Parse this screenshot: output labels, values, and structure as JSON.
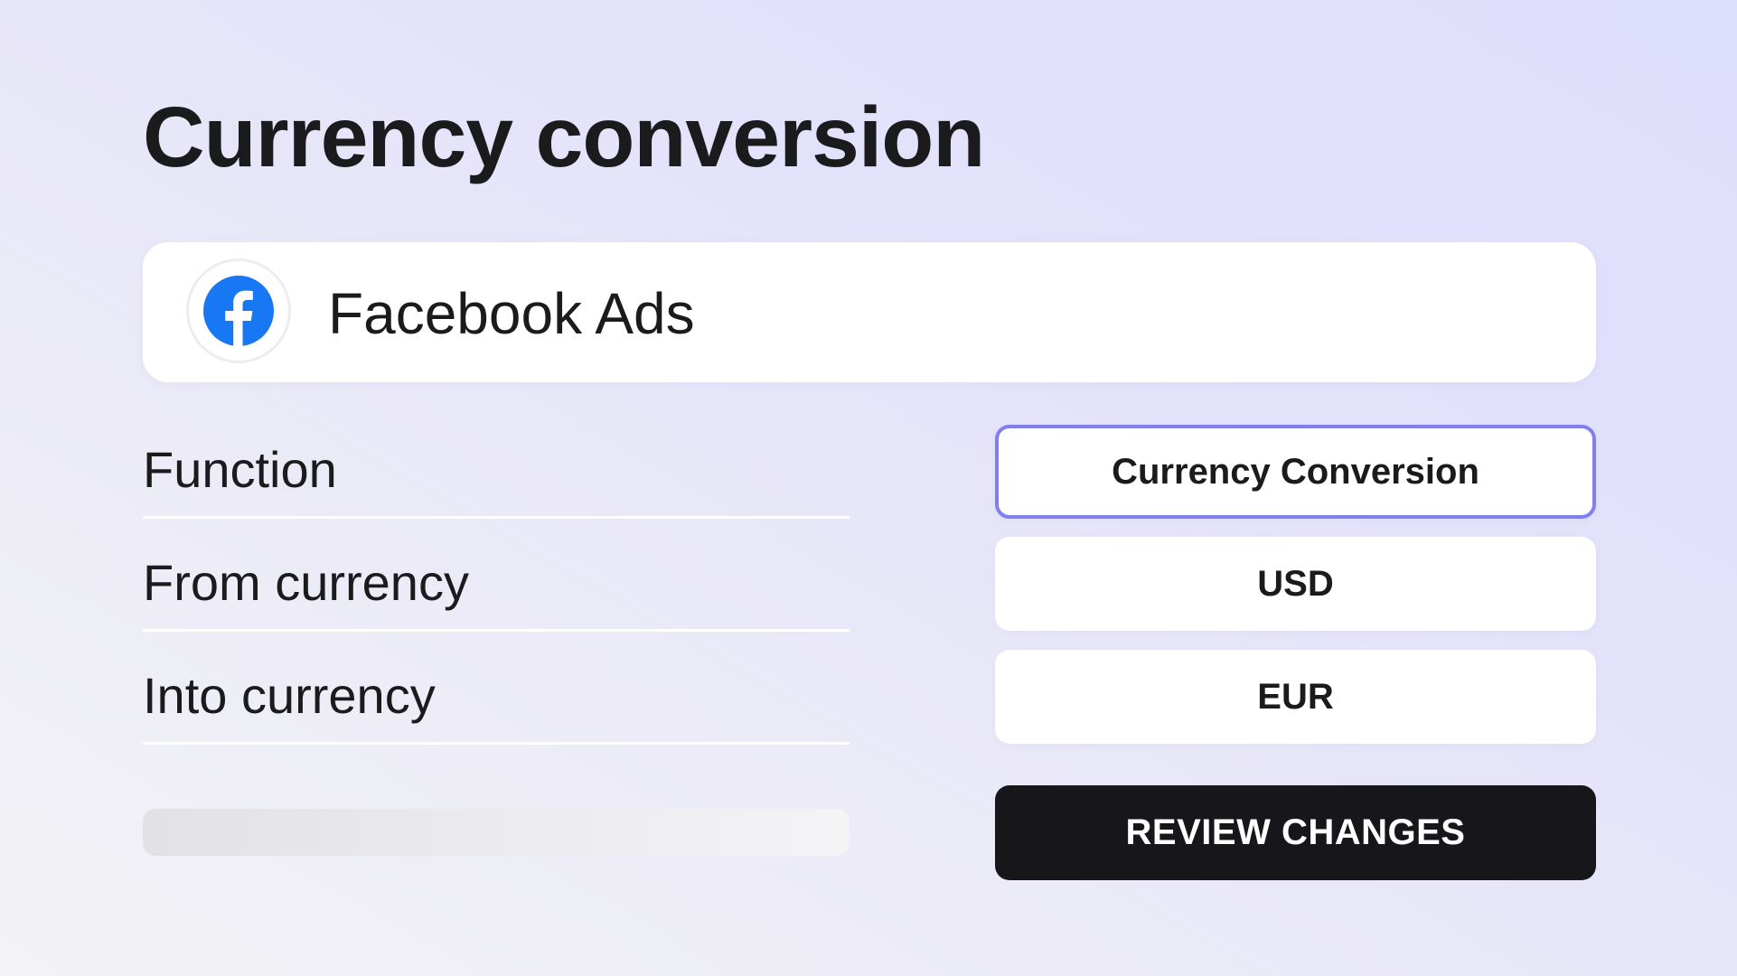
{
  "page": {
    "title": "Currency conversion"
  },
  "source": {
    "name": "Facebook Ads",
    "logo_icon": "facebook-logo-icon",
    "brand_color": "#1877F2"
  },
  "fields": [
    {
      "label": "Function",
      "value": "Currency Conversion",
      "selected": true
    },
    {
      "label": "From currency",
      "value": "USD",
      "selected": false
    },
    {
      "label": "Into currency",
      "value": "EUR",
      "selected": false
    }
  ],
  "actions": {
    "review_label": "REVIEW CHANGES"
  },
  "colors": {
    "accent_border": "#7F7FF0",
    "button_bg": "#17171B"
  }
}
